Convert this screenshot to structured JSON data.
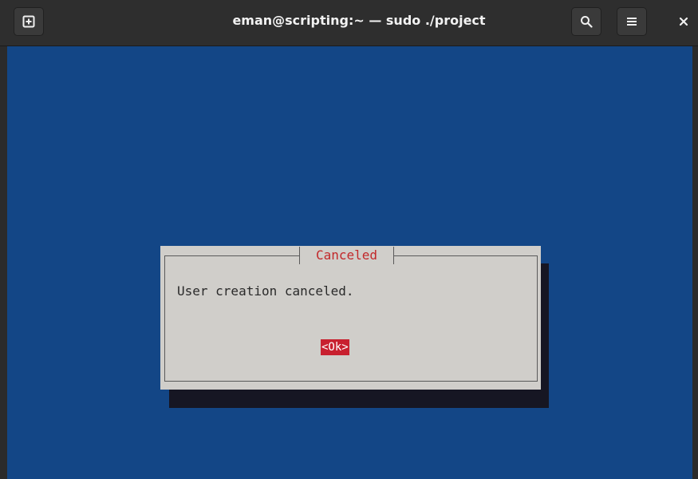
{
  "window": {
    "title": "eman@scripting:~ — sudo ./project"
  },
  "toolbar": {
    "new_tab_icon": "new-tab-icon",
    "search_icon": "search-icon",
    "menu_icon": "hamburger-menu-icon",
    "close_icon": "close-icon"
  },
  "dialog": {
    "title": "Canceled",
    "message": "User creation canceled.",
    "ok_label": "<Ok>"
  },
  "colors": {
    "terminal_bg": "#134686",
    "dialog_bg": "#d0ceca",
    "dialog_title": "#c2282a",
    "ok_button_bg": "#c8202f",
    "titlebar_bg": "#2e2e2e"
  }
}
